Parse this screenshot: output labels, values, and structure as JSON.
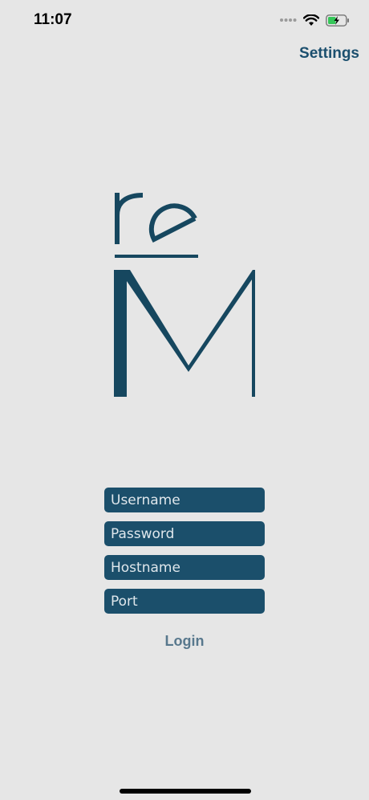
{
  "status_bar": {
    "time": "11:07",
    "icons": [
      "signal-dots-icon",
      "wifi-icon",
      "battery-charging-icon"
    ]
  },
  "header": {
    "settings_label": "Settings"
  },
  "logo": {
    "brand_color": "#16475f"
  },
  "form": {
    "username_placeholder": "Username",
    "password_placeholder": "Password",
    "hostname_placeholder": "Hostname",
    "port_placeholder": "Port",
    "login_label": "Login"
  },
  "colors": {
    "background": "#e6e6e6",
    "accent": "#1b4f6b",
    "login_text": "#58788d"
  }
}
